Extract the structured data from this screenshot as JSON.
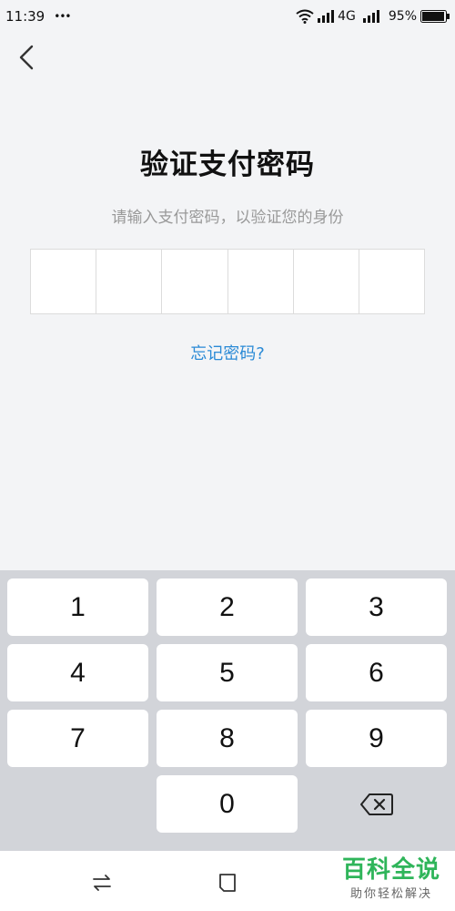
{
  "status_bar": {
    "time": "11:39",
    "dots": "•••",
    "network": "4G",
    "battery": "95%"
  },
  "page": {
    "title": "验证支付密码",
    "subtitle": "请输入支付密码，以验证您的身份",
    "forgot_link": "忘记密码?"
  },
  "pin": {
    "length": 6,
    "entered": 0
  },
  "keyboard": {
    "keys": [
      "1",
      "2",
      "3",
      "4",
      "5",
      "6",
      "7",
      "8",
      "9",
      "",
      "0",
      "⌫"
    ]
  },
  "watermark": {
    "title": "百科全说",
    "subtitle": "助你轻松解决"
  },
  "colors": {
    "link": "#2a8ad6",
    "background": "#f3f4f6",
    "keyboard_bg": "#d2d4d9",
    "watermark": "#2fb55a"
  }
}
